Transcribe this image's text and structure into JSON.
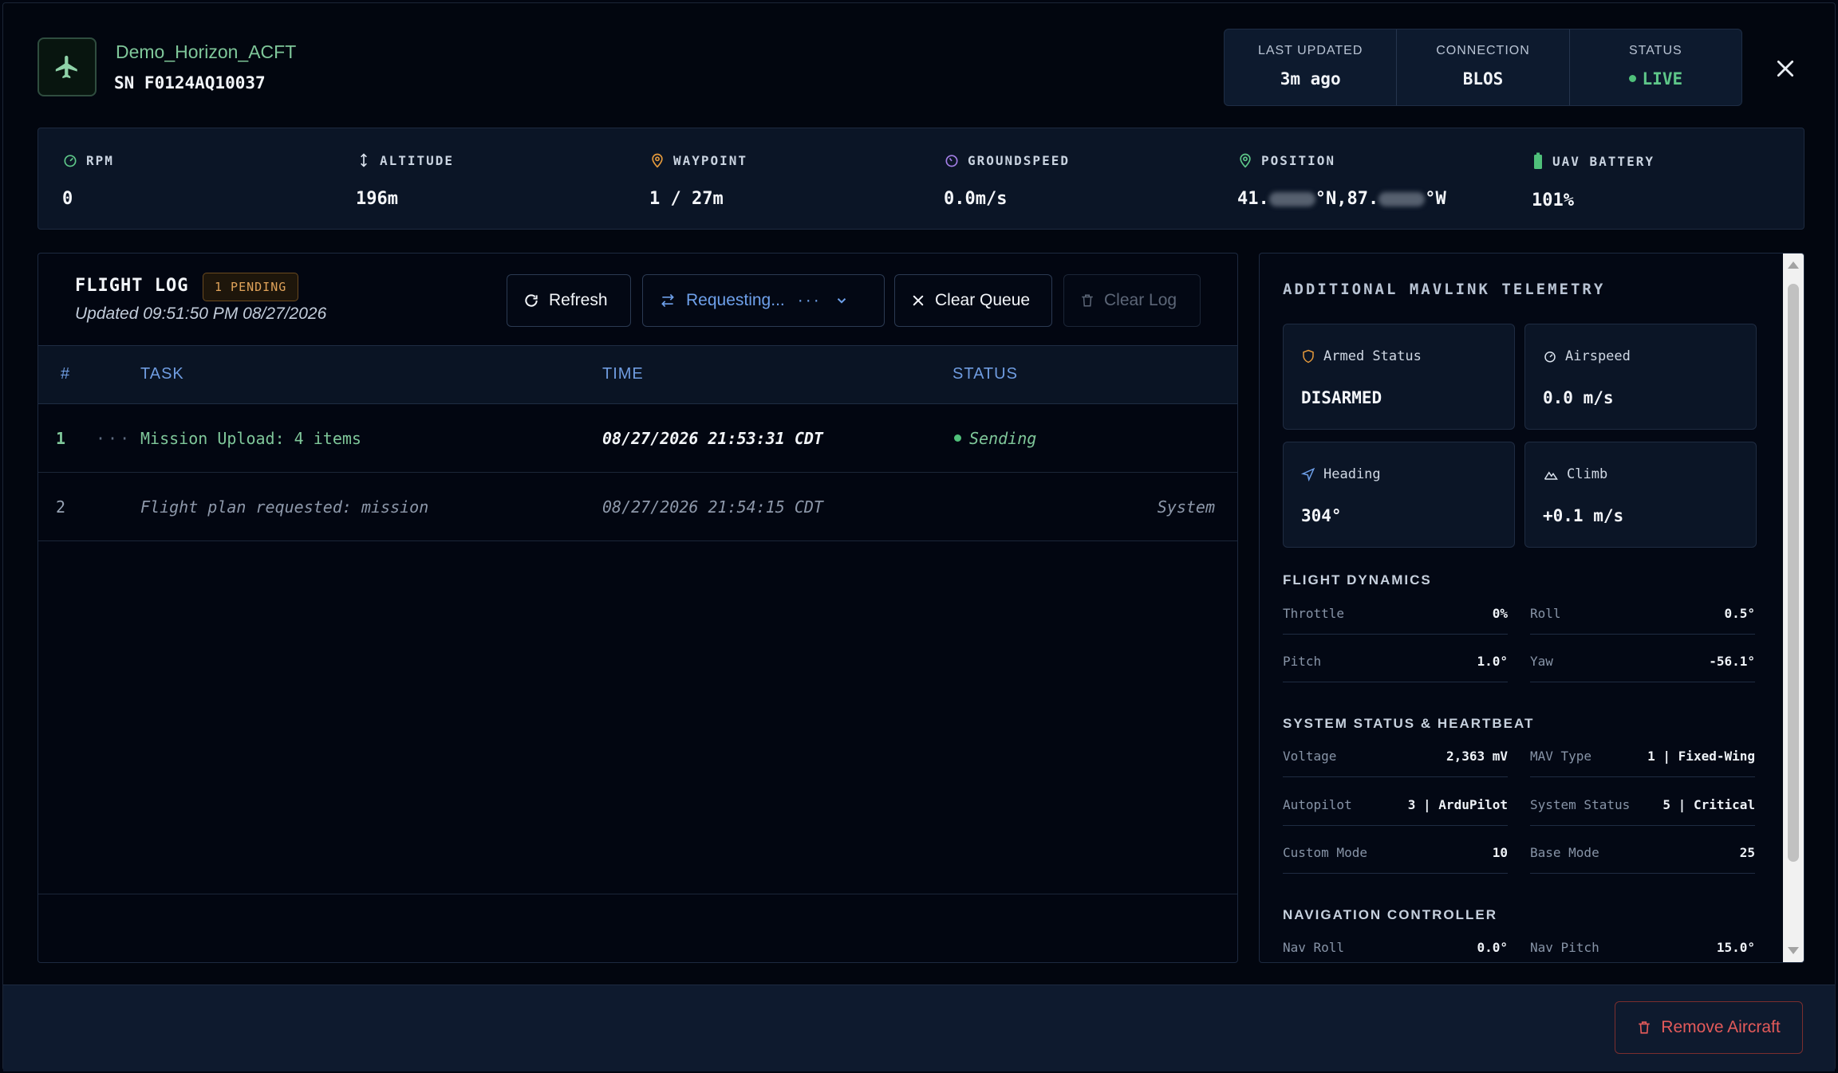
{
  "header": {
    "aircraft_name": "Demo_Horizon_ACFT",
    "serial": "SN F0124AQ10037",
    "icon": "airplane-icon",
    "stats": [
      {
        "label": "LAST UPDATED",
        "value": "3m ago"
      },
      {
        "label": "CONNECTION",
        "value": "BLOS"
      },
      {
        "label": "STATUS",
        "value": "LIVE"
      }
    ],
    "close_icon": "close-icon"
  },
  "metrics": {
    "rpm": {
      "label": "RPM",
      "value": "0",
      "icon": "gauge-icon"
    },
    "altitude": {
      "label": "ALTITUDE",
      "value": "196m",
      "icon": "vertical-arrows-icon"
    },
    "waypoint": {
      "label": "WAYPOINT",
      "value": "1 / 27m",
      "icon": "map-pin-icon"
    },
    "groundspeed": {
      "label": "GROUNDSPEED",
      "value": "0.0m/s",
      "icon": "speedometer-icon"
    },
    "position": {
      "label": "POSITION",
      "lat_prefix": "41.",
      "lat_suffix": "°N,87.",
      "lon_suffix": "°W",
      "icon": "location-pin-icon"
    },
    "battery": {
      "label": "UAV BATTERY",
      "value": "101%",
      "icon": "battery-icon"
    }
  },
  "flight_log": {
    "title": "FLIGHT LOG",
    "pending_badge": "1 PENDING",
    "updated": "Updated  09:51:50 PM 08/27/2026",
    "buttons": {
      "refresh": "Refresh",
      "requesting": "Requesting...",
      "clear_queue": "Clear Queue",
      "clear_log": "Clear Log"
    },
    "columns": [
      "#",
      "TASK",
      "TIME",
      "STATUS"
    ],
    "rows": [
      {
        "num": "1",
        "marker": "···",
        "task": "Mission Upload: 4 items",
        "time": "08/27/2026 21:53:31 CDT",
        "status": "Sending"
      },
      {
        "num": "2",
        "marker": "",
        "task": "Flight plan requested: mission",
        "time": "08/27/2026 21:54:15 CDT",
        "status": "System"
      }
    ]
  },
  "telemetry": {
    "title": "ADDITIONAL MAVLINK TELEMETRY",
    "cards": [
      {
        "label": "Armed Status",
        "value": "DISARMED",
        "icon": "shield-icon"
      },
      {
        "label": "Airspeed",
        "value": "0.0 m/s",
        "icon": "speedometer-icon"
      },
      {
        "label": "Heading",
        "value": "304°",
        "icon": "navigation-arrow-icon"
      },
      {
        "label": "Climb",
        "value": "+0.1 m/s",
        "icon": "mountain-icon"
      }
    ],
    "flight_dynamics": {
      "title": "FLIGHT DYNAMICS",
      "items": [
        {
          "k": "Throttle",
          "v": "0%"
        },
        {
          "k": "Roll",
          "v": "0.5°"
        },
        {
          "k": "Pitch",
          "v": "1.0°"
        },
        {
          "k": "Yaw",
          "v": "-56.1°"
        }
      ]
    },
    "system_status": {
      "title": "SYSTEM STATUS & HEARTBEAT",
      "items": [
        {
          "k": "Voltage",
          "v": "2,363 mV"
        },
        {
          "k": "MAV Type",
          "v": "1 | Fixed-Wing"
        },
        {
          "k": "Autopilot",
          "v": "3 | ArduPilot"
        },
        {
          "k": "System Status",
          "v": "5 | Critical"
        },
        {
          "k": "Custom Mode",
          "v": "10"
        },
        {
          "k": "Base Mode",
          "v": "25"
        }
      ]
    },
    "navigation": {
      "title": "NAVIGATION CONTROLLER",
      "items": [
        {
          "k": "Nav Roll",
          "v": "0.0°"
        },
        {
          "k": "Nav Pitch",
          "v": "15.0°"
        }
      ]
    }
  },
  "footer": {
    "remove_label": "Remove Aircraft"
  },
  "colors": {
    "accent_green": "#7fc79a",
    "accent_blue": "#6f9ce0",
    "pending_orange": "#e0a35a",
    "danger_red": "#e35a5a",
    "background": "#02060f"
  }
}
